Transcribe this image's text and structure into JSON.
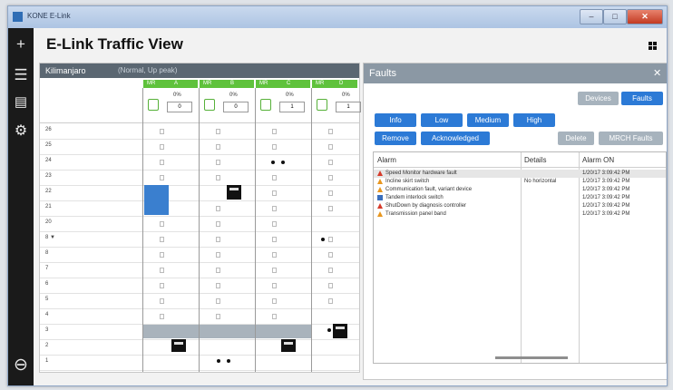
{
  "window": {
    "title": "KONE E-Link"
  },
  "app": {
    "title": "E-Link Traffic View"
  },
  "sidebar": {
    "icons": [
      "plus-icon",
      "menu-icon",
      "list-icon",
      "gear-icon",
      "minus-circle-icon"
    ]
  },
  "left_panel": {
    "group_name": "Kilimanjaro",
    "group_status": "(Normal, Up peak)",
    "cars": [
      {
        "band_left": "MR",
        "band_right": "A",
        "percent": "0%",
        "count": "0"
      },
      {
        "band_left": "MR",
        "band_right": "B",
        "percent": "0%",
        "count": "0"
      },
      {
        "band_left": "MR",
        "band_right": "C",
        "percent": "0%",
        "count": "1"
      },
      {
        "band_left": "MR",
        "band_right": "D",
        "percent": "0%",
        "count": "1"
      }
    ],
    "floors": [
      "26",
      "25",
      "24",
      "23",
      "22",
      "21",
      "20",
      "8 ▼",
      "8",
      "7",
      "6",
      "5",
      "4",
      "3",
      "2",
      "1"
    ]
  },
  "faults_panel": {
    "title": "Faults",
    "close": "✕",
    "tabs": {
      "devices": "Devices",
      "faults": "Faults"
    },
    "filters": [
      "Info",
      "Low",
      "Medium",
      "High"
    ],
    "actions": {
      "remove": "Remove",
      "acknowledge": "Acknowledged",
      "delete": "Delete",
      "ownfaults": "MRCH Faults"
    },
    "columns": {
      "alarm": "Alarm",
      "details": "Details",
      "alarm_on": "Alarm ON"
    },
    "alarms": [
      {
        "severity": "red",
        "text": "Speed Monitor hardware fault",
        "details": "",
        "time": "1/20/17 3:09:42 PM"
      },
      {
        "severity": "orange",
        "text": "Incline skirt switch",
        "details": "No horizontal",
        "time": "1/20/17 3:09:42 PM"
      },
      {
        "severity": "orange",
        "text": "Communication fault, variant device",
        "details": "",
        "time": "1/20/17 3:09:42 PM"
      },
      {
        "severity": "blue",
        "text": "Tandem interlock switch",
        "details": "",
        "time": "1/20/17 3:09:42 PM"
      },
      {
        "severity": "red",
        "text": "ShutDown by diagnosis controller",
        "details": "",
        "time": "1/20/17 3:09:42 PM"
      },
      {
        "severity": "orange",
        "text": "Transmission panel band",
        "details": "",
        "time": "1/20/17 3:09:42 PM"
      }
    ]
  },
  "colors": {
    "accent": "#2c7ad6",
    "car_band": "#5fc23c",
    "sidebar": "#1a1a1a"
  }
}
